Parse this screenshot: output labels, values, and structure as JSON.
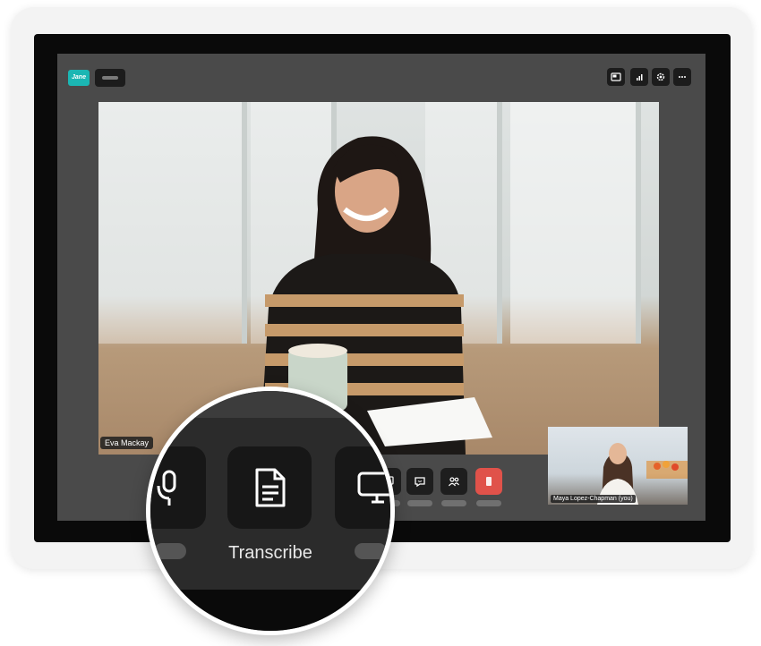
{
  "app": {
    "logo_text": "Jane"
  },
  "video": {
    "participant_name": "Eva Mackay"
  },
  "self_view": {
    "name": "Maya Lopez-Chapman (you)"
  },
  "magnifier": {
    "highlight_label": "Transcribe"
  },
  "colors": {
    "screen_bg": "#4a4a4a",
    "brand_teal": "#1bb6b3",
    "end_call_red": "#e0524a"
  }
}
